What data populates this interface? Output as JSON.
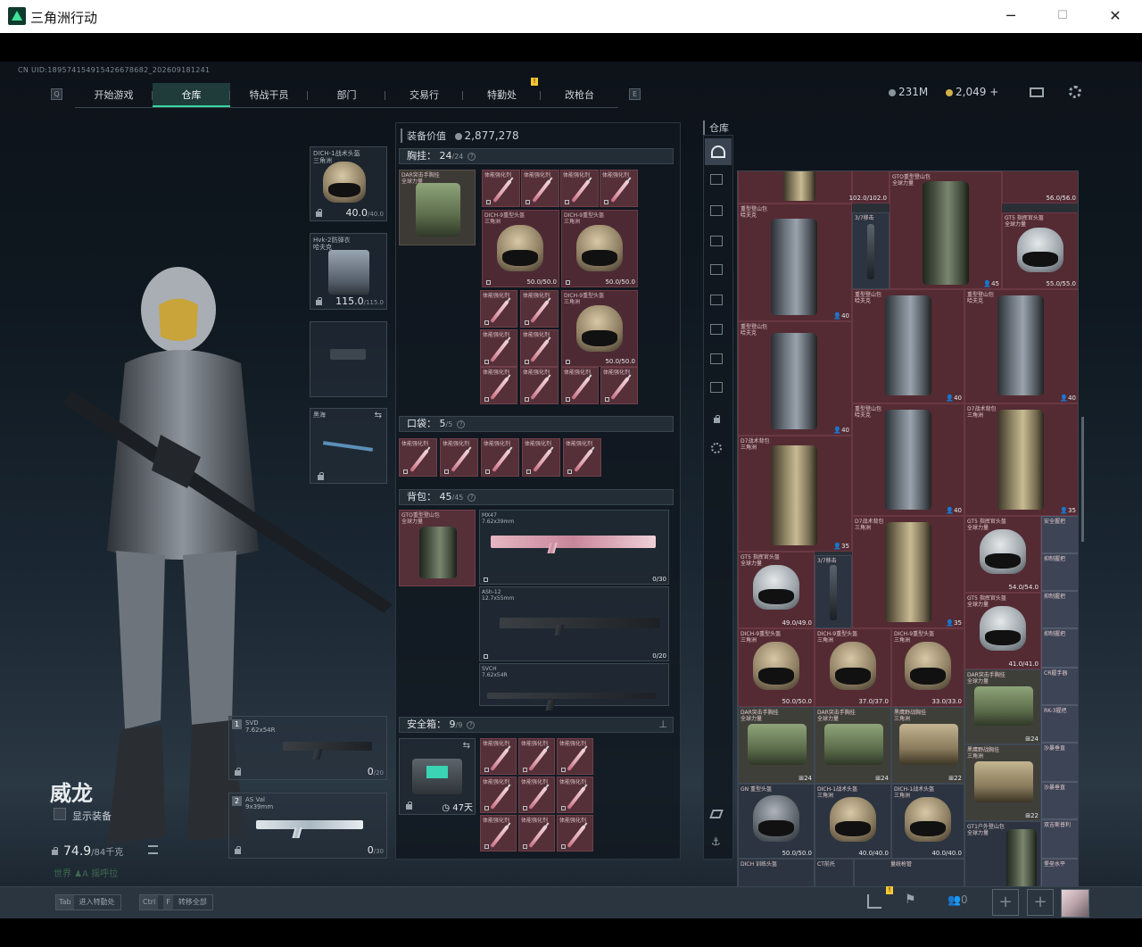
{
  "window": {
    "title": "三角洲行动",
    "min": "─",
    "max": "☐",
    "close": "✕"
  },
  "uid": "CN UID:18957415491542667868​2_202609181241",
  "nav": {
    "left_key": "Q",
    "right_key": "E",
    "tabs": [
      "开始游戏",
      "仓库",
      "特战干员",
      "部门",
      "交易行",
      "特勤处",
      "改枪台"
    ],
    "active": 1,
    "badge": "!"
  },
  "currency": {
    "coins": "231M",
    "bonds": "2,049",
    "plus": "+"
  },
  "equip_value": {
    "label": "装备价值",
    "value": "2,877,278"
  },
  "slots": {
    "helmet": {
      "name": "DICH-1战术头盔",
      "sub": "三角洲",
      "value": "40.0",
      "max": "/40.0"
    },
    "armor": {
      "name": "Hvk-2防弹衣",
      "sub": "哈夫克",
      "value": "115.0",
      "max": "/115.0"
    },
    "melee": {
      "name": "黑海"
    },
    "primary": {
      "num": "1",
      "name": "SVD",
      "sub": "7.62x54R",
      "ammo": "0",
      "max": "/20"
    },
    "secondary": {
      "num": "2",
      "name": "AS Val",
      "sub": "9x39mm",
      "ammo": "0",
      "max": "/30"
    }
  },
  "chest": {
    "label": "胸挂：",
    "count": "24",
    "max": "/24",
    "rig": "DAR突击手胸挂",
    "rig_sub": "全球力量"
  },
  "pocket": {
    "label": "口袋：",
    "count": "5",
    "max": "/5"
  },
  "backpack": {
    "label": "背包：",
    "count": "45",
    "max": "/45",
    "pack": "GTO重型登山包",
    "pack_sub": "全球力量"
  },
  "safe": {
    "label": "安全箱：",
    "count": "9",
    "max": "/9",
    "days": "47天"
  },
  "item_names": {
    "syringe": "体能强化剂",
    "helm9": "DICH-9重型头盔",
    "helm9_sub": "三角洲",
    "helm_val": "50.0/50.0"
  },
  "guns": [
    {
      "name": "MX47",
      "sub": "7.62x39mm",
      "ammo": "0/30"
    },
    {
      "name": "ASh-12",
      "sub": "12.7x55mm",
      "ammo": "0/20"
    },
    {
      "name": "SVCH",
      "sub": "7.62x54R",
      "ammo": ""
    }
  ],
  "storage": {
    "label": "仓库"
  },
  "store_items": {
    "gt0": "GTO重型登山包",
    "gt0_sub": "全球力量",
    "heavy": "重型登山包",
    "heavy_sub": "哈夫克",
    "scope": "3/7移击",
    "d7": "D7战术背包",
    "d7_sub": "三角洲",
    "gt5": "GT5 指挥官头盔",
    "gt5_sub": "全球力量",
    "dich9": "DICH-9重型头盔",
    "dich9_sub": "三角洲",
    "dar": "DAR突击手胸挂",
    "dar_sub": "全球力量",
    "heihu": "黑鹰野战胸挂",
    "heihu_sub": "三角洲",
    "gn": "GN 重型头盔",
    "dich1": "DICH-1战术头盔",
    "dich1_sub": "三角洲",
    "gt1": "GT1户外登山包",
    "gt1_sub": "全球力量",
    "ct": "CT前托",
    "dich_train": "DICH 训练头盔",
    "mei": "量统枪管",
    "an": "安全握把",
    "hand1": "抑制握把",
    "hand2": "抑制握把",
    "hand3": "抑制握把",
    "cr": "CR握手器",
    "rk": "RK-3握把",
    "sha": "沙暴垂直",
    "sha2": "沙暴垂直",
    "dun": "双吉斯普利",
    "bz": "堡垒水平",
    "v1": "102.0/102.0",
    "v2": "56.0/56.0",
    "v3": "55.0/55.0",
    "v4": "54.0/54.0",
    "v5": "49.0/49.0",
    "v6": "41.0/41.0",
    "v7": "50.0/50.0",
    "v8": "37.0/37.0",
    "v9": "33.0/33.0",
    "v10": "40.0/40.0",
    "n45": "45",
    "n40": "40",
    "n35": "35",
    "n24": "24",
    "n22": "22"
  },
  "character": {
    "name": "威龙",
    "show_equip": "显示装备",
    "weight": "74.9",
    "weight_max": "/84千克",
    "world": "世界",
    "tag": "A",
    "player": "摇呼拉"
  },
  "bottom": {
    "tab_key": "Tab",
    "tab_label": "进入特勤处",
    "ctrl_key": "Ctrl",
    "f_key": "F",
    "ctrl_label": "转移全部",
    "party": "0",
    "badge": "!"
  }
}
